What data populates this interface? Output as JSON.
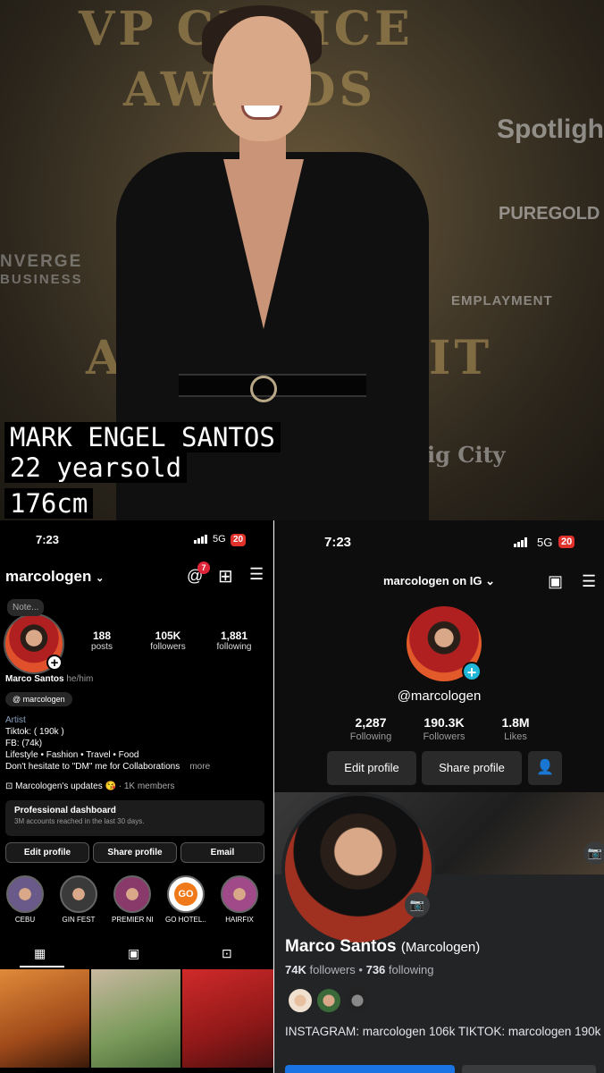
{
  "photo": {
    "bg_text_1": "VP CHOICE",
    "bg_text_2": "AWARDS",
    "bg_text_3": "Spotlight",
    "bg_text_4": "PUREGOLD",
    "bg_text_5": "NVERGE",
    "bg_text_6": "BUSINESS",
    "bg_text_7": "EMPLAYMENT",
    "bg_text_8": "AW",
    "bg_text_9": "IT",
    "bg_text_10": "ig City",
    "caption_name": "MARK ENGEL SANTOS",
    "caption_age": "22 yearsold",
    "caption_height": "176cm"
  },
  "instagram": {
    "status": {
      "time": "7:23",
      "network": "5G",
      "battery": "20"
    },
    "username": "marcologen",
    "threads_badge": "7",
    "note": "Note...",
    "stats": [
      {
        "value": "188",
        "label": "posts"
      },
      {
        "value": "105K",
        "label": "followers"
      },
      {
        "value": "1,881",
        "label": "following"
      }
    ],
    "display_name": "Marco Santos",
    "pronouns": "he/him",
    "threads_handle": "marcologen",
    "category": "Artist",
    "bio_line1": "Tiktok: ( 190k )",
    "bio_line2": "FB: (74k)",
    "bio_line3": "Lifestyle • Fashion • Travel • Food",
    "bio_line4": "Don't hesitate to \"DM\" me for Collaborations",
    "more": "more",
    "channel_name": "Marcologen's updates",
    "channel_members": "· 1K members",
    "dashboard_title": "Professional dashboard",
    "dashboard_sub": "3M accounts reached in the last 30 days.",
    "buttons": {
      "edit": "Edit profile",
      "share": "Share profile",
      "email": "Email"
    },
    "highlights": [
      {
        "label": "CEBU"
      },
      {
        "label": "GIN FEST"
      },
      {
        "label": "PREMIER NI..."
      },
      {
        "label": "GO HOTEL..."
      },
      {
        "label": "HAIRFIX"
      }
    ]
  },
  "tiktok": {
    "status": {
      "time": "7:23",
      "network": "5G",
      "battery": "20"
    },
    "title": "marcologen on IG",
    "handle": "@marcologen",
    "stats": [
      {
        "value": "2,287",
        "label": "Following"
      },
      {
        "value": "190.3K",
        "label": "Followers"
      },
      {
        "value": "1.8M",
        "label": "Likes"
      }
    ],
    "buttons": {
      "edit": "Edit profile",
      "share": "Share profile"
    }
  },
  "facebook": {
    "name": "Marco Santos",
    "nickname": "(Marcologen)",
    "followers_value": "74K",
    "followers_label": "followers",
    "separator": "•",
    "following_value": "736",
    "following_label": "following",
    "bio": "INSTAGRAM: marcologen 106k TIKTOK: marcologen 190k"
  },
  "colors": {
    "ig_bg": "#000000",
    "tt_bg": "#0d0d0d",
    "fb_bg": "#232426",
    "tiktok_accent": "#21b8d8",
    "fb_blue": "#1b74e4",
    "badge_red": "#e0312b"
  }
}
